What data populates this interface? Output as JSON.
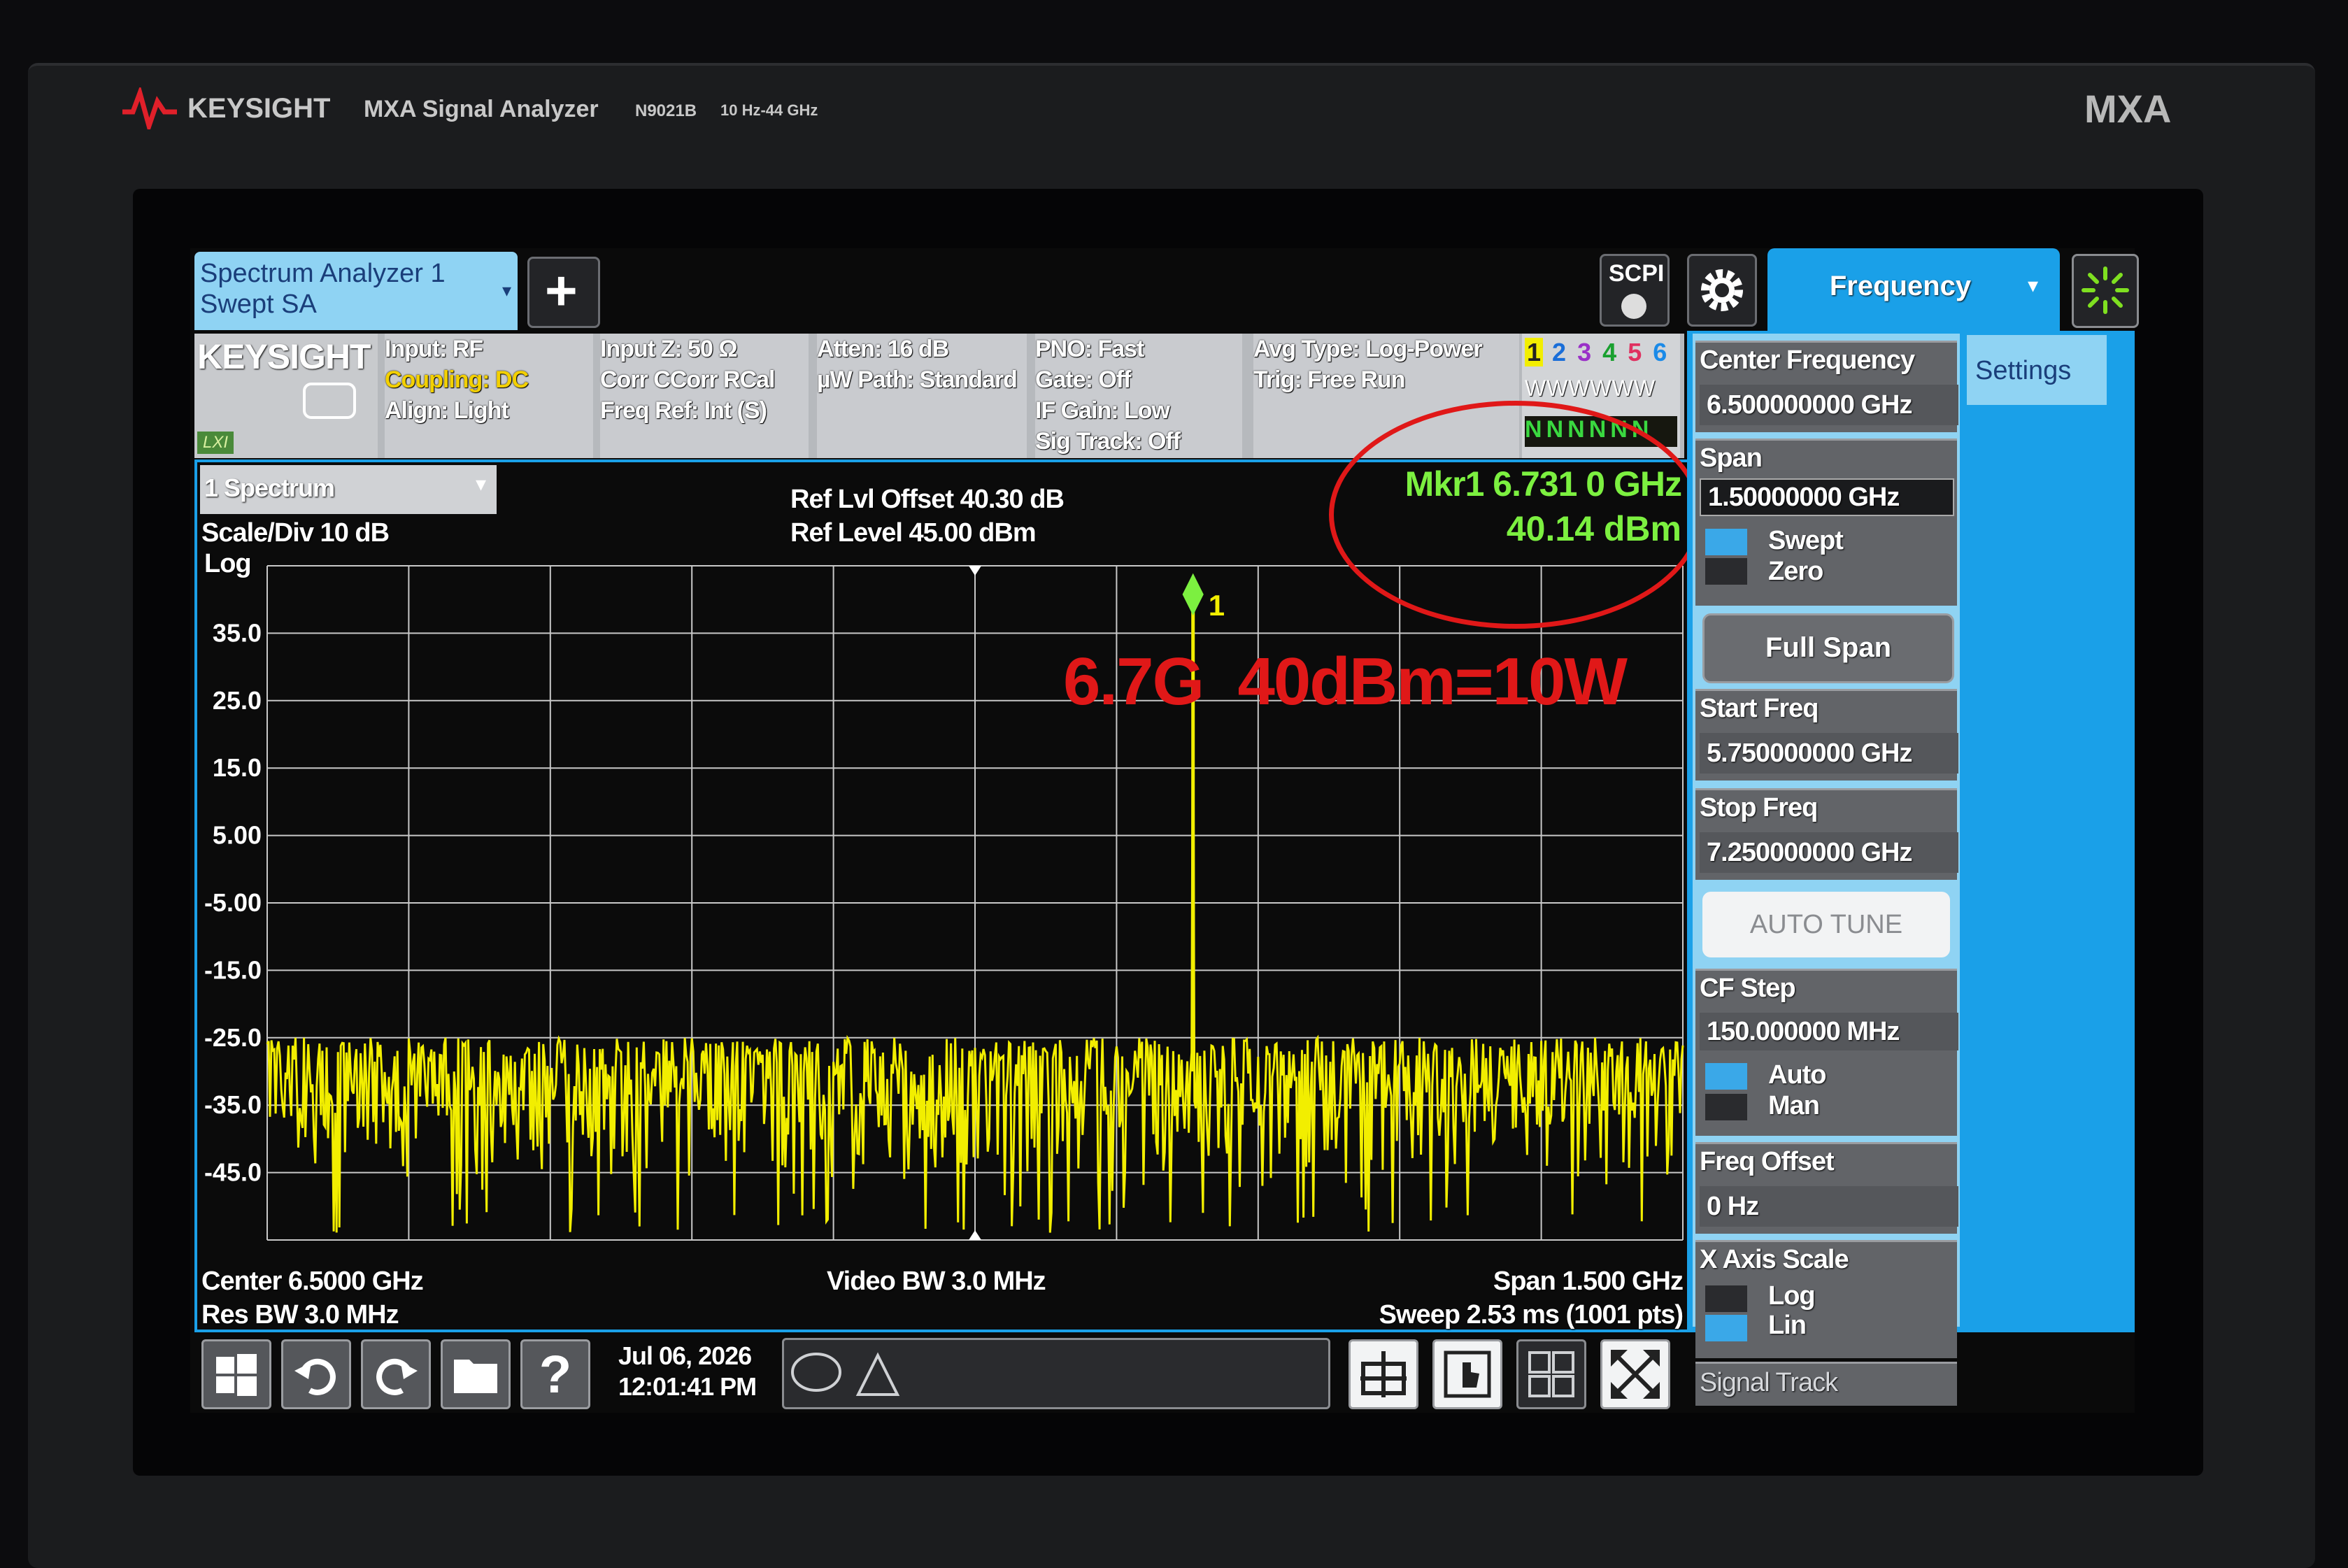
{
  "brand": {
    "logo": "KEYSIGHT",
    "product": "MXA Signal Analyzer",
    "model": "N9021B",
    "range": "10 Hz-44 GHz",
    "badge": "MXA"
  },
  "top_bar": {
    "tab_line1": "Spectrum Analyzer 1",
    "tab_line2": "Swept SA",
    "add_icon": "plus-icon",
    "scpi_label": "SCPI",
    "menu_title": "Frequency",
    "settings_tab": "Settings"
  },
  "status": {
    "logo": "KEYSIGHT",
    "lxi": "LXI",
    "col1": [
      "Input: RF",
      "Coupling: DC",
      "Align: Light"
    ],
    "col2": [
      "Input Z: 50 Ω",
      "Corr CCorr RCal",
      "Freq Ref: Int (S)"
    ],
    "col3": [
      "Atten: 16 dB",
      "µW Path: Standard"
    ],
    "col4": [
      "PNO: Fast",
      "Gate: Off",
      "IF Gain: Low",
      "Sig Track: Off"
    ],
    "col5": [
      "Avg Type: Log-Power",
      "Trig: Free Run"
    ],
    "traces": [
      "1",
      "2",
      "3",
      "4",
      "5",
      "6"
    ],
    "trace_types": [
      "W",
      "W",
      "W",
      "W",
      "W",
      "W"
    ],
    "trace_det": [
      "N",
      "N",
      "N",
      "N",
      "N",
      "N"
    ]
  },
  "window": {
    "name": "1 Spectrum",
    "scale": "Scale/Div 10 dB",
    "mode": "Log",
    "ref_offset": "Ref Lvl Offset 40.30 dB",
    "ref_level": "Ref Level 45.00 dBm",
    "marker_freq": "Mkr1 6.731 0 GHz",
    "marker_amp": "40.14 dBm",
    "marker_label": "1",
    "annotation": "6.7G  40dBm=10W",
    "center": "Center 6.5000 GHz",
    "res_bw": "Res BW 3.0 MHz",
    "video_bw": "Video BW 3.0 MHz",
    "span": "Span 1.500 GHz",
    "sweep": "Sweep 2.53 ms (1001 pts)"
  },
  "chart_data": {
    "type": "line",
    "y_ticks": [
      "35.0",
      "25.0",
      "15.0",
      "5.00",
      "-5.00",
      "-15.0",
      "-25.0",
      "-35.0",
      "-45.0"
    ],
    "xlim_ghz": [
      5.75,
      7.25
    ],
    "ylim_dbm": [
      -55,
      45
    ],
    "noise_floor_dbm": -28,
    "noise_low_dbm": -50,
    "points": 1001,
    "peak": {
      "x_ghz": 6.731,
      "y_dbm": 40.14
    },
    "trace_color": "#f2ee00"
  },
  "softkeys": [
    {
      "label": "Center Frequency",
      "value": "6.500000000 GHz"
    },
    {
      "label": "Span",
      "value": "1.50000000 GHz"
    },
    {
      "label": "Swept",
      "label2": "Zero"
    },
    {
      "label": "Full Span"
    },
    {
      "label": "Start Freq",
      "value": "5.750000000 GHz"
    },
    {
      "label": "Stop Freq",
      "value": "7.250000000 GHz"
    },
    {
      "label": "AUTO TUNE"
    },
    {
      "label": "CF Step",
      "value": "150.000000 MHz"
    },
    {
      "label": "Auto",
      "label2": "Man"
    },
    {
      "label": "Freq Offset",
      "value": "0 Hz"
    },
    {
      "label": "X Axis Scale",
      "opt1": "Log",
      "opt2": "Lin"
    },
    {
      "label": "Signal Track"
    }
  ],
  "taskbar": {
    "date": "Jul 06, 2026",
    "time": "12:01:41 PM"
  },
  "colors": {
    "accent": "#1aa0e8",
    "trace": "#f2ee00",
    "marker_text": "#7cf040",
    "annotation": "#e01818"
  }
}
